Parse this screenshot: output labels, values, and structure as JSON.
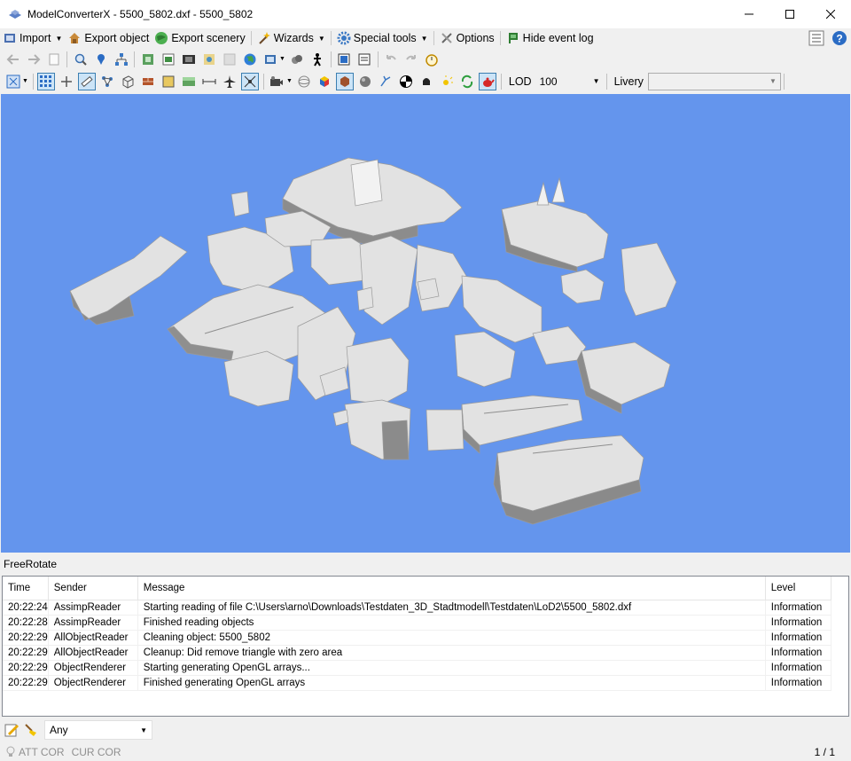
{
  "window": {
    "title": "ModelConverterX - 5500_5802.dxf - 5500_5802"
  },
  "menu": [
    {
      "label": "Import",
      "icon": "import-icon",
      "dropdown": true
    },
    {
      "label": "Export object",
      "icon": "export-object-icon",
      "dropdown": false
    },
    {
      "label": "Export scenery",
      "icon": "globe-icon",
      "dropdown": false
    },
    {
      "label": "Wizards",
      "icon": "wand-icon",
      "dropdown": true
    },
    {
      "label": "Special tools",
      "icon": "gear-icon",
      "dropdown": true
    },
    {
      "label": "Options",
      "icon": "tools-icon",
      "dropdown": false
    },
    {
      "label": "Hide event log",
      "icon": "event-log-icon",
      "dropdown": false
    }
  ],
  "toolbar3": {
    "lod_label": "LOD",
    "lod_value": "100",
    "livery_label": "Livery",
    "livery_value": ""
  },
  "mode": {
    "label": "FreeRotate"
  },
  "log": {
    "columns": [
      "Time",
      "Sender",
      "Message",
      "Level"
    ],
    "rows": [
      [
        "20:22:24",
        "AssimpReader",
        "Starting reading of file C:\\Users\\arno\\Downloads\\Testdaten_3D_Stadtmodell\\Testdaten\\LoD2\\5500_5802.dxf",
        "Information"
      ],
      [
        "20:22:28",
        "AssimpReader",
        "Finished reading objects",
        "Information"
      ],
      [
        "20:22:29",
        "AllObjectReader",
        "Cleaning object: 5500_5802",
        "Information"
      ],
      [
        "20:22:29",
        "AllObjectReader",
        "Cleanup: Did remove triangle with zero area",
        "Information"
      ],
      [
        "20:22:29",
        "ObjectRenderer",
        "Starting generating OpenGL arrays...",
        "Information"
      ],
      [
        "20:22:29",
        "ObjectRenderer",
        "Finished generating OpenGL arrays",
        "Information"
      ]
    ]
  },
  "filter": {
    "value": "Any"
  },
  "status": {
    "att": "ATT COR",
    "cur": "CUR COR",
    "pager": "1 / 1"
  },
  "colors": {
    "viewport": "#6495ed",
    "building": "#e4e4e4"
  }
}
